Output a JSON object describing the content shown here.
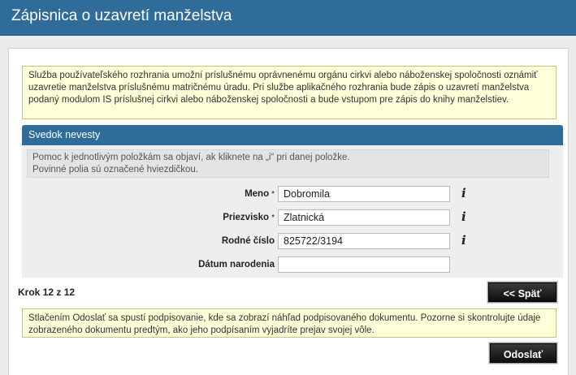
{
  "header": {
    "title": "Zápisnica o uzavretí manželstva"
  },
  "notice_top": "Služba používateľského rozhrania umožní príslušnému oprávnenému orgánu cirkvi alebo náboženskej spoločnosti oznámiť uzavretie manželstva príslušnému matričnému úradu. Pri službe aplikačného rozhrania bude zápis o uzavretí manželstva podaný modulom IS príslušnej cirkvi alebo náboženskej spoločnosti a bude vstupom pre zápis do knihy manželstiev.",
  "section": {
    "title": "Svedok nevesty",
    "help_line1": "Pomoc k jednotlivým položkám sa objaví, ak kliknete na „i“ pri danej položke.",
    "help_line2": "Povinné polia sú označené hviezdičkou."
  },
  "fields": {
    "first_name": {
      "label": "Meno",
      "required": "*",
      "value": "Dobromila"
    },
    "surname": {
      "label": "Priezvisko",
      "required": "*",
      "value": "Zlatnická"
    },
    "birth_number": {
      "label": "Rodné číslo",
      "value": "825722/3194"
    },
    "birth_date": {
      "label": "Dátum narodenia",
      "value": ""
    }
  },
  "info_glyph": "i",
  "step": "Krok 12 z 12",
  "buttons": {
    "back": "<< Späť",
    "send": "Odoslať"
  },
  "notice_bottom": "Stlačením Odoslať sa spustí podpisovanie, kde sa zobrazí náhľad podpisovaného dokumentu. Pozorne si skontrolujte údaje zobrazeného dokumentu predtým, ako jeho podpísaním vyjadríte prejav svojej vôle.",
  "colors": {
    "header": "#2f6c99",
    "notice_bg": "#ffffd9",
    "button": "#1a1a1a"
  }
}
